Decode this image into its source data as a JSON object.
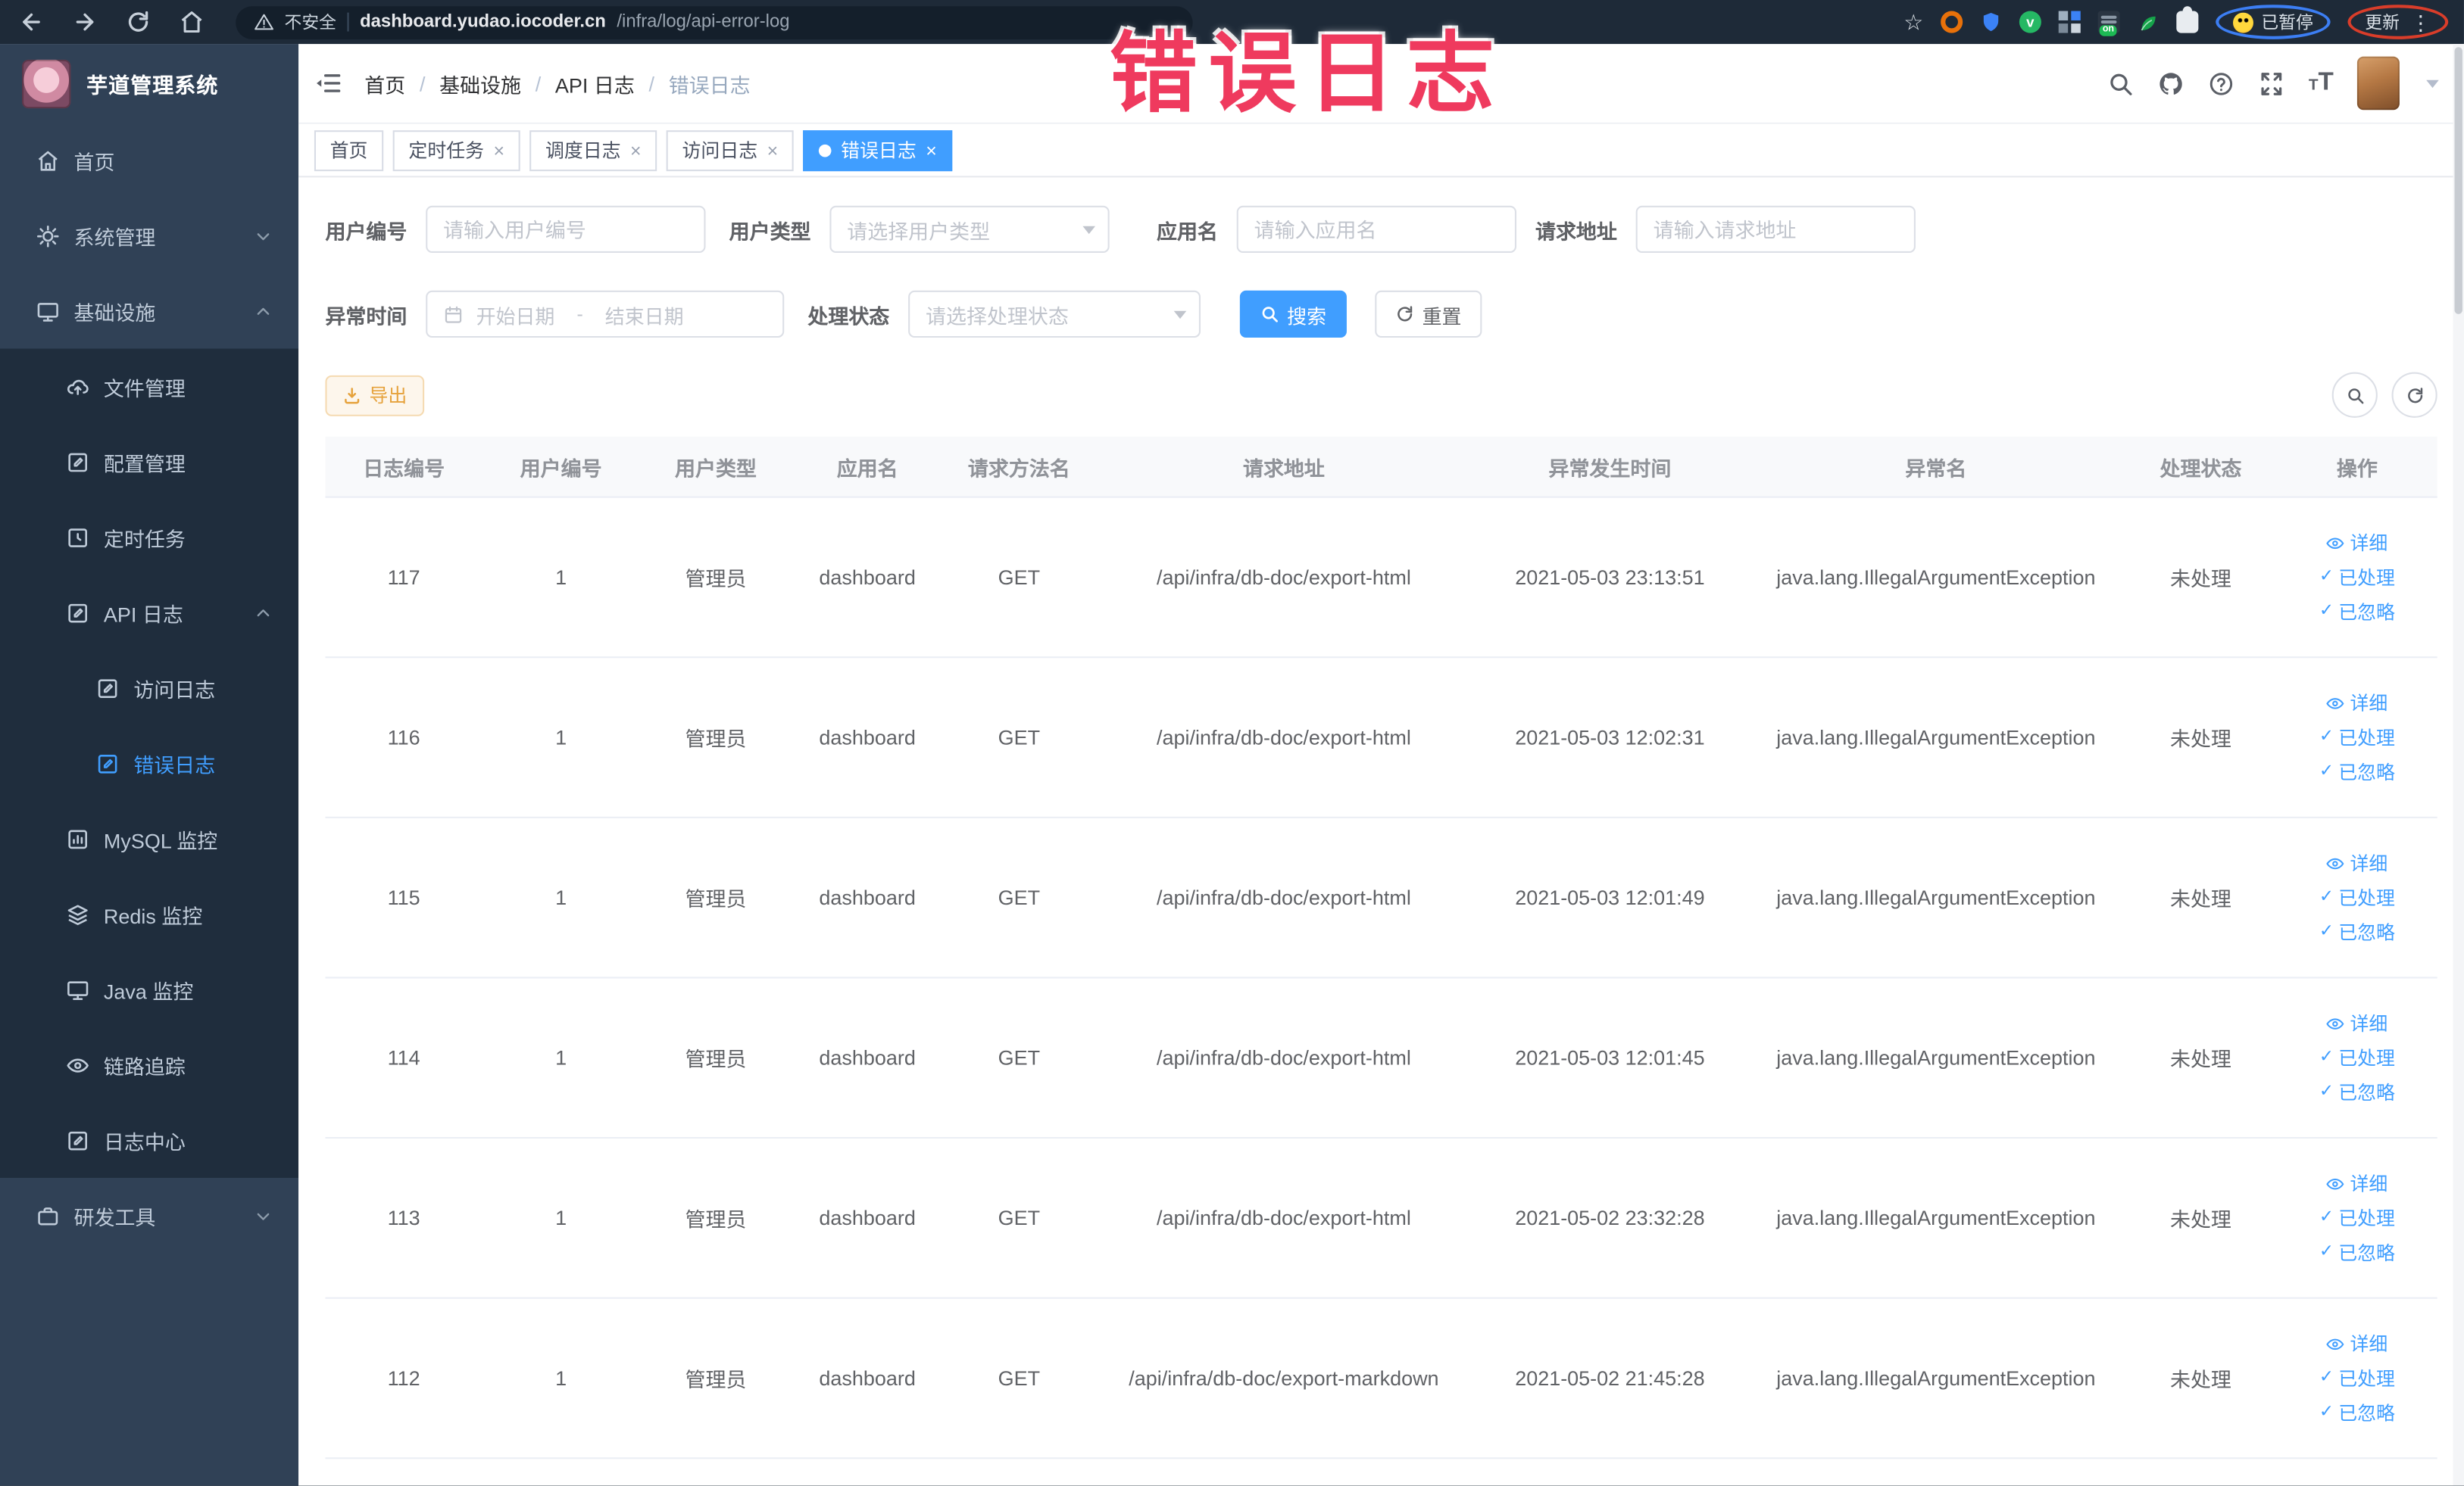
{
  "annotation": {
    "title": "错误日志",
    "color": "#ef3a5e"
  },
  "browser": {
    "security_label": "不安全",
    "url_domain": "dashboard.yudao.iocoder.cn",
    "url_path": "/infra/log/api-error-log",
    "paused_badge": "已暂停",
    "update_button": "更新",
    "on_badge": "on",
    "menu_glyph": "⋮",
    "star_glyph": "☆"
  },
  "sidebar": {
    "title": "芋道管理系统",
    "items": [
      {
        "label": "首页"
      },
      {
        "label": "系统管理"
      },
      {
        "label": "基础设施"
      },
      {
        "label": "文件管理"
      },
      {
        "label": "配置管理"
      },
      {
        "label": "定时任务"
      },
      {
        "label": "API 日志"
      },
      {
        "label": "访问日志"
      },
      {
        "label": "错误日志"
      },
      {
        "label": "MySQL 监控"
      },
      {
        "label": "Redis 监控"
      },
      {
        "label": "Java 监控"
      },
      {
        "label": "链路追踪"
      },
      {
        "label": "日志中心"
      },
      {
        "label": "研发工具"
      }
    ]
  },
  "header": {
    "breadcrumb": [
      "首页",
      "基础设施",
      "API 日志",
      "错误日志"
    ],
    "separator": "/"
  },
  "tabs": {
    "close_glyph": "×",
    "items": [
      {
        "label": "首页"
      },
      {
        "label": "定时任务"
      },
      {
        "label": "调度日志"
      },
      {
        "label": "访问日志"
      },
      {
        "label": "错误日志"
      }
    ]
  },
  "filters": {
    "user_id": {
      "label": "用户编号",
      "placeholder": "请输入用户编号",
      "value": ""
    },
    "user_type": {
      "label": "用户类型",
      "placeholder": "请选择用户类型"
    },
    "app_name": {
      "label": "应用名",
      "placeholder": "请输入应用名",
      "value": ""
    },
    "request_url": {
      "label": "请求地址",
      "placeholder": "请输入请求地址",
      "value": ""
    },
    "exception_time": {
      "label": "异常时间",
      "start_placeholder": "开始日期",
      "separator": "-",
      "end_placeholder": "结束日期"
    },
    "process_status": {
      "label": "处理状态",
      "placeholder": "请选择处理状态"
    },
    "search_button": "搜索",
    "reset_button": "重置"
  },
  "toolbar": {
    "export_button": "导出"
  },
  "table": {
    "columns": [
      "日志编号",
      "用户编号",
      "用户类型",
      "应用名",
      "请求方法名",
      "请求地址",
      "异常发生时间",
      "异常名",
      "处理状态",
      "操作"
    ],
    "actions": [
      "详细",
      "已处理",
      "已忽略"
    ],
    "check_glyph": "✓",
    "rows": [
      {
        "id": "117",
        "user_id": "1",
        "user_type": "管理员",
        "app": "dashboard",
        "method": "GET",
        "url": "/api/infra/db-doc/export-html",
        "time": "2021-05-03 23:13:51",
        "exception": "java.lang.IllegalArgumentException",
        "status": "未处理"
      },
      {
        "id": "116",
        "user_id": "1",
        "user_type": "管理员",
        "app": "dashboard",
        "method": "GET",
        "url": "/api/infra/db-doc/export-html",
        "time": "2021-05-03 12:02:31",
        "exception": "java.lang.IllegalArgumentException",
        "status": "未处理"
      },
      {
        "id": "115",
        "user_id": "1",
        "user_type": "管理员",
        "app": "dashboard",
        "method": "GET",
        "url": "/api/infra/db-doc/export-html",
        "time": "2021-05-03 12:01:49",
        "exception": "java.lang.IllegalArgumentException",
        "status": "未处理"
      },
      {
        "id": "114",
        "user_id": "1",
        "user_type": "管理员",
        "app": "dashboard",
        "method": "GET",
        "url": "/api/infra/db-doc/export-html",
        "time": "2021-05-03 12:01:45",
        "exception": "java.lang.IllegalArgumentException",
        "status": "未处理"
      },
      {
        "id": "113",
        "user_id": "1",
        "user_type": "管理员",
        "app": "dashboard",
        "method": "GET",
        "url": "/api/infra/db-doc/export-html",
        "time": "2021-05-02 23:32:28",
        "exception": "java.lang.IllegalArgumentException",
        "status": "未处理"
      },
      {
        "id": "112",
        "user_id": "1",
        "user_type": "管理员",
        "app": "dashboard",
        "method": "GET",
        "url": "/api/infra/db-doc/export-markdown",
        "time": "2021-05-02 21:45:28",
        "exception": "java.lang.IllegalArgumentException",
        "status": "未处理"
      }
    ]
  },
  "colors": {
    "primary": "#409eff",
    "warning": "#e6a23c",
    "sidebar_bg": "#304156",
    "submenu_bg": "#1f2d3d",
    "browser_bar_bg": "#1e2a38",
    "active_tab": "#409eff"
  }
}
